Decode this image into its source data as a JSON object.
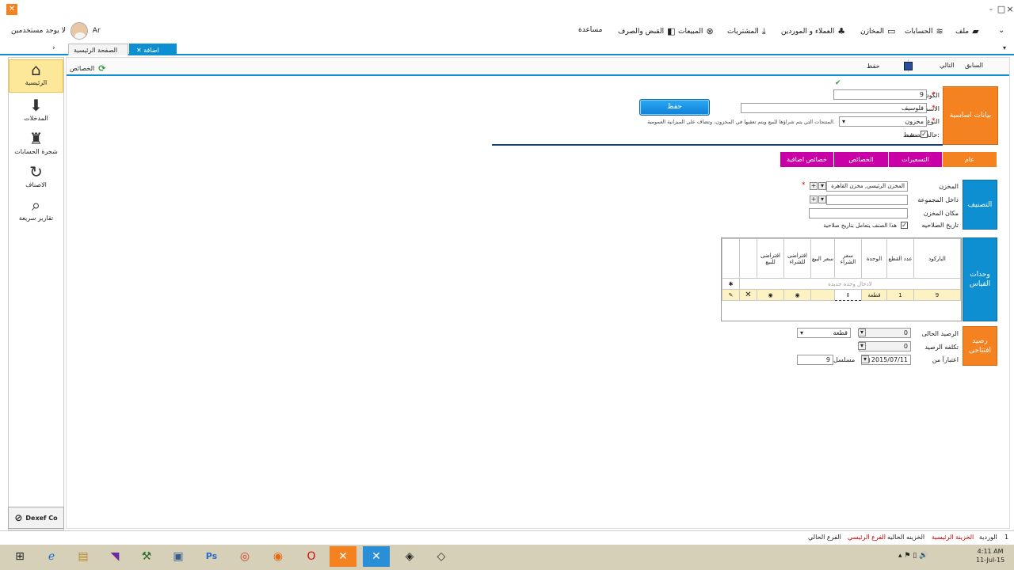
{
  "window": {
    "minimize": "-",
    "restore": "□",
    "close": "×"
  },
  "user": {
    "name": "Ar",
    "status": "لا يوجد مستخدمين"
  },
  "menu": [
    "ملف",
    "الحسابات",
    "المخازن",
    "العملاء و الموردين",
    "المشتريات",
    "المبيعات",
    "القبض والصرف",
    "مساعدة"
  ],
  "tabs": {
    "home": "الصفحة الرئيسية",
    "add_item": "اضافة صنف"
  },
  "sidebar": {
    "items": [
      {
        "label": "الرئيسية",
        "icon": "home-icon"
      },
      {
        "label": "المدخلات",
        "icon": "download-icon"
      },
      {
        "label": "شجرة الحسابات",
        "icon": "tree-icon"
      },
      {
        "label": "الاصناف",
        "icon": "refresh-icon"
      },
      {
        "label": "تقارير سريعة",
        "icon": "search-icon"
      }
    ],
    "company": "Dexef Co"
  },
  "toolbar": {
    "prev": "السابق",
    "next": "التالي",
    "save": "حفظ",
    "properties": "الخصائص"
  },
  "basic": {
    "section": "بيانات اساسية",
    "code_label": "الكود",
    "code": "9",
    "name_label": "الاسم",
    "name": "فلوسيف",
    "type_label": "النوع",
    "type": "مخزون",
    "type_note": "المنتجات التي يتم شراؤها للبيع ويتم تعقبها في المخزون، وتضاف على الميزانية العمومية.",
    "status_label": "حالة الصنف:",
    "status_value": "نشط",
    "save_button": "حفظ"
  },
  "category_tabs": [
    "عام",
    "التسعيرات",
    "الخصائص",
    "خصائص اضافية"
  ],
  "classification": {
    "section": "التصنيف",
    "store_label": "المخزن",
    "store": "المخزن الرئيسي, مخزن القاهرة",
    "group_label": "داخل المجموعة",
    "location_label": "مكان المخزن",
    "expiry_label": "تاريخ الصلاحيه",
    "expiry_check": "هذا الصنف يتعامل بتاريخ صلاحية"
  },
  "units": {
    "section": "وحدات القياس",
    "columns": [
      "الباركود",
      "عدد القطع",
      "الوحدة",
      "سعر الشراء",
      "سعر البيع",
      "افتراضى للشراء",
      "افتراضى للبيع"
    ],
    "new_row": "لادخال وحدة جديدة",
    "row": {
      "barcode": "9",
      "count": "1",
      "unit": "قطعة"
    }
  },
  "opening": {
    "section": "رصيد افتتاحى",
    "current_label": "الرصيد الحالى",
    "current": "0",
    "unit": "قطعة",
    "cost_label": "تكلفه الرصيد",
    "cost": "0",
    "as_of_label": "اعتبارآ من",
    "date": "2015/07/11",
    "serial_label": "مسلسل",
    "serial": "9"
  },
  "status": [
    "1",
    "الوردية",
    "الخزينة الرئيسية",
    "الخزينه الحاليه",
    "الفرع الرئيسي",
    "الفرع الحالي"
  ],
  "clock": {
    "time": "4:11 AM",
    "date": "11-Jul-15"
  }
}
